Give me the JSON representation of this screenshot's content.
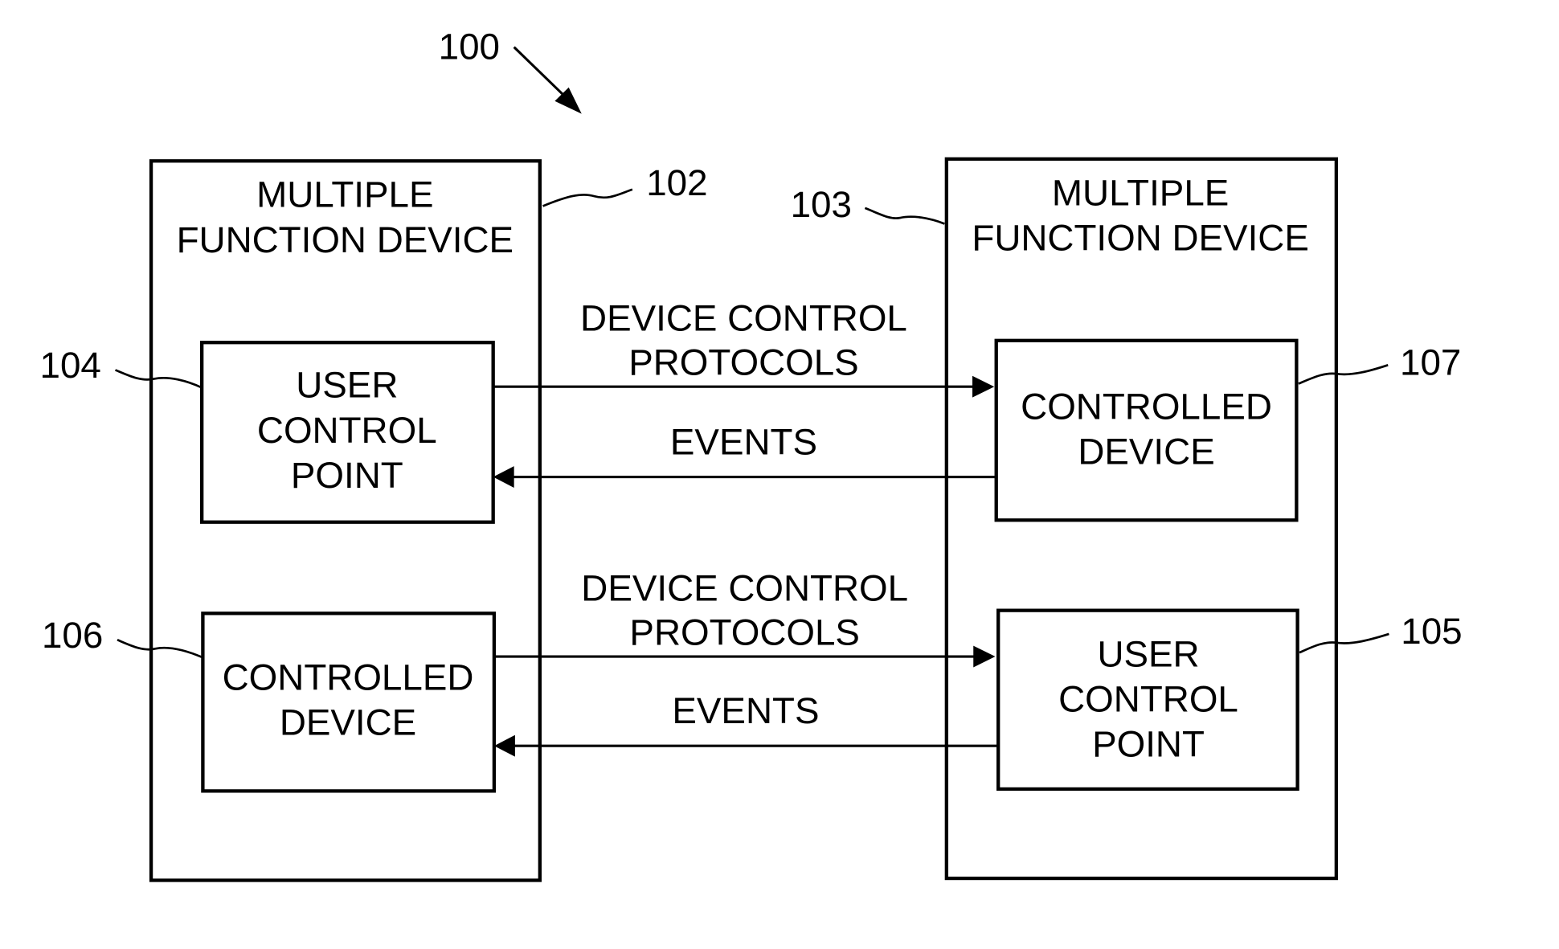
{
  "figure": {
    "ref": "100",
    "devices": [
      {
        "id": "left",
        "ref": "102",
        "title_line1": "MULTIPLE",
        "title_line2": "FUNCTION DEVICE",
        "components": [
          {
            "ref": "104",
            "lines": [
              "USER",
              "CONTROL",
              "POINT"
            ]
          },
          {
            "ref": "106",
            "lines": [
              "CONTROLLED",
              "DEVICE"
            ]
          }
        ]
      },
      {
        "id": "right",
        "ref": "103",
        "title_line1": "MULTIPLE",
        "title_line2": "FUNCTION DEVICE",
        "components": [
          {
            "ref": "107",
            "lines": [
              "CONTROLLED",
              "DEVICE"
            ]
          },
          {
            "ref": "105",
            "lines": [
              "USER",
              "CONTROL",
              "POINT"
            ]
          }
        ]
      }
    ],
    "connections": [
      {
        "label_line1": "DEVICE CONTROL",
        "label_line2": "PROTOCOLS",
        "from": "104",
        "to": "107"
      },
      {
        "label": "EVENTS",
        "from": "107",
        "to": "104"
      },
      {
        "label_line1": "DEVICE CONTROL",
        "label_line2": "PROTOCOLS",
        "from": "106",
        "to": "105"
      },
      {
        "label": "EVENTS",
        "from": "105",
        "to": "106"
      }
    ]
  }
}
